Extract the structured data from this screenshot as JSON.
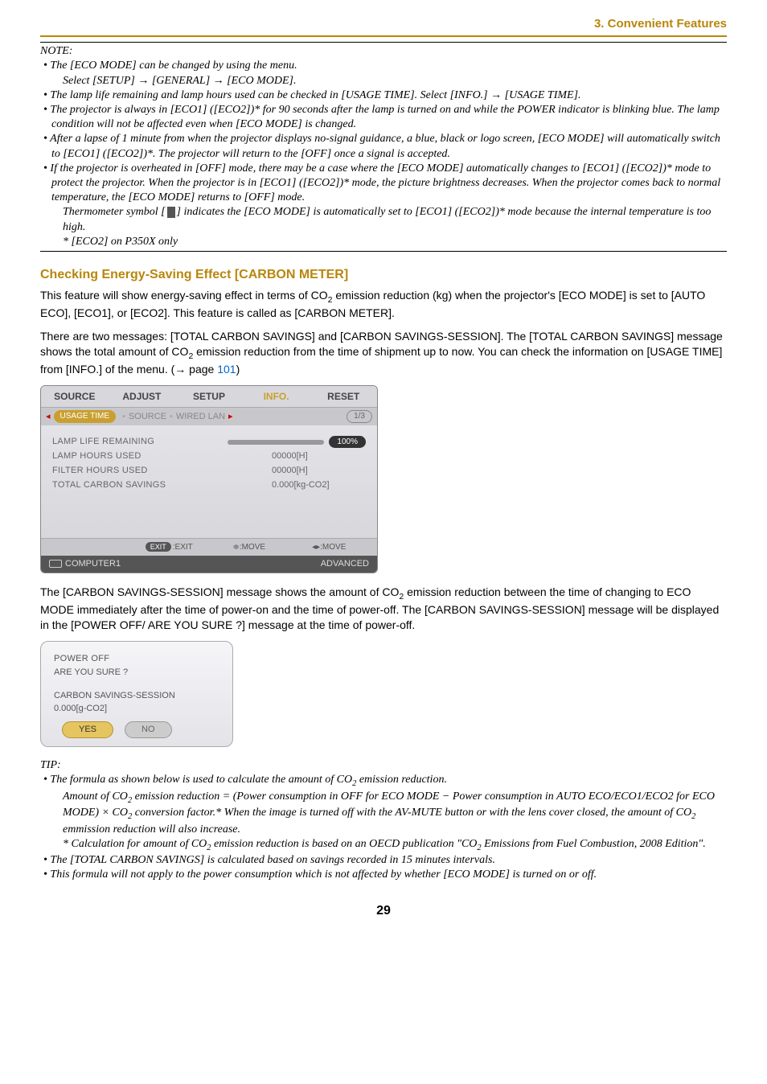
{
  "header": {
    "section": "3. Convenient Features"
  },
  "note": {
    "label": "NOTE:",
    "items": [
      "The [ECO MODE] can be changed by using the menu.",
      "The lamp life remaining and lamp hours used can be checked in [USAGE TIME]. Select [INFO.] → [USAGE TIME].",
      "The projector is always in [ECO1] ([ECO2])* for 90 seconds after the lamp is turned on and while the POWER indicator is blinking blue. The lamp condition will not be affected even when [ECO MODE] is changed.",
      "After a lapse of 1 minute from when the projector displays no-signal guidance, a blue, black or logo screen, [ECO MODE] will automatically switch to [ECO1] ([ECO2])*. The projector will return to the [OFF] once a signal is accepted.",
      "If the projector is overheated in [OFF] mode, there may be a case where the [ECO MODE] automatically changes to [ECO1] ([ECO2])* mode to protect the projector. When the projector is in [ECO1] ([ECO2])* mode, the picture brightness decreases. When the projector comes back to normal temperature, the [ECO MODE] returns to [OFF] mode."
    ],
    "item1_sub": "Select [SETUP] → [GENERAL] → [ECO MODE].",
    "therm_pre": "Thermometer symbol [",
    "therm_post": "] indicates the [ECO MODE] is automatically set to [ECO1] ([ECO2])* mode because the internal temperature is too high.",
    "foot": "* [ECO2] on P350X only"
  },
  "carbon": {
    "heading": "Checking Energy-Saving Effect [CARBON METER]",
    "p1a": "This feature will show energy-saving effect in terms of CO",
    "p1b": " emission reduction (kg) when the projector's [ECO MODE] is set to [AUTO ECO], [ECO1], or [ECO2]. This feature is called as [CARBON METER].",
    "p2a": "There are two messages: [TOTAL CARBON SAVINGS] and [CARBON SAVINGS-SESSION]. The [TOTAL CARBON SAVINGS] message shows the total amount of CO",
    "p2b": " emission reduction from the time of shipment up to now. You can check the information on [USAGE TIME] from [INFO.] of the menu. (→ page ",
    "p2_page": "101",
    "p2c": ")"
  },
  "osd": {
    "tabs": {
      "source": "SOURCE",
      "adjust": "ADJUST",
      "setup": "SETUP",
      "info": "INFO.",
      "reset": "RESET"
    },
    "subtabs": {
      "usage": "USAGE TIME",
      "src": "SOURCE",
      "wired": "WIRED LAN",
      "page": "1/3"
    },
    "rows": {
      "lamp_life": "LAMP LIFE REMAINING",
      "lamp_hours": "LAMP HOURS USED",
      "filter_hours": "FILTER HOURS USED",
      "carbon": "TOTAL CARBON SAVINGS",
      "lamp_hours_v": "00000[H]",
      "filter_hours_v": "00000[H]",
      "carbon_v": "0.000[kg-CO2]",
      "pct": "100%"
    },
    "footer": {
      "exit_pill": "EXIT",
      "exit": ":EXIT",
      "move1": "≑:MOVE",
      "move2": "◂▸:MOVE"
    },
    "bottom": {
      "src": "COMPUTER1",
      "adv": "ADVANCED"
    }
  },
  "carbon2": {
    "p3a": "The [CARBON SAVINGS-SESSION] message shows the amount of CO",
    "p3b": " emission reduction between the time of changing to ECO MODE immediately after the time of power-on and the time of power-off. The [CARBON SAVINGS-SESSION] message will be displayed in the [POWER OFF/ ARE YOU SURE ?] message at the time of power-off."
  },
  "dialog": {
    "title": "POWER OFF",
    "sub": "ARE YOU SURE ?",
    "carbon": "CARBON SAVINGS-SESSION",
    "val": "0.000[g-CO2]",
    "yes": "YES",
    "no": "NO"
  },
  "tip": {
    "label": "TIP:",
    "b1a": "The formula as shown below is used to calculate the amount of CO",
    "b1b": " emission reduction.",
    "b1_suba": "Amount of CO",
    "b1_subb": " emission reduction = (Power consumption in OFF for ECO MODE − Power consumption in AUTO ECO/ECO1/ECO2 for ECO MODE) × CO",
    "b1_subc": " conversion factor.* When the image is turned off with the AV-MUTE button or with the lens cover closed, the amount of CO",
    "b1_subd": " emmission reduction will also increase.",
    "b1_star_a": "* Calculation for amount of CO",
    "b1_star_b": " emission reduction is based on an OECD publication \"CO",
    "b1_star_c": " Emissions from Fuel Combustion, 2008 Edition\".",
    "b2": "The [TOTAL CARBON SAVINGS] is calculated based on savings recorded in 15 minutes intervals.",
    "b3": "This formula will not apply to the power consumption which is not affected by whether [ECO MODE] is turned on or off."
  },
  "page_num": "29"
}
